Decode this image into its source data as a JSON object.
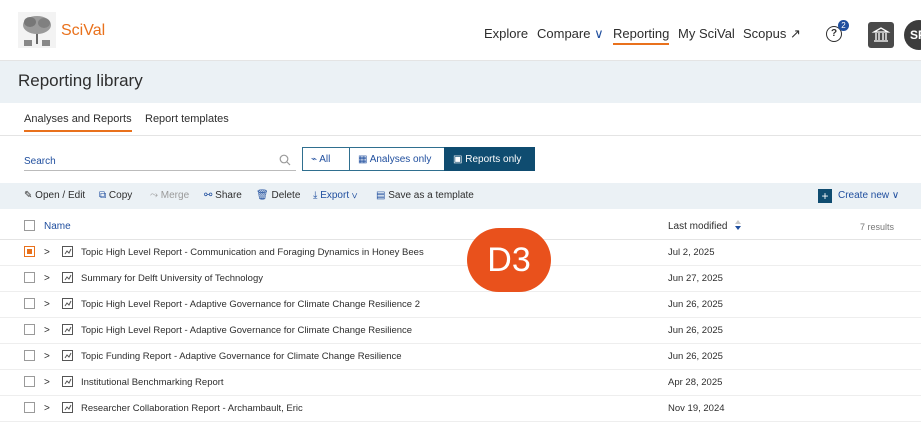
{
  "header": {
    "brand": "SciVal",
    "nav": [
      "Explore",
      "Compare",
      "Reporting",
      "My SciVal",
      "Scopus ↗"
    ],
    "compare_chevron": "∨",
    "help_glyph": "?",
    "help_badge": "2",
    "avatar_initials": "SF"
  },
  "page": {
    "title": "Reporting library"
  },
  "tabs": [
    "Analyses and Reports",
    "Report templates"
  ],
  "filters": {
    "search_label": "Search",
    "segments": [
      "All",
      "Analyses only",
      "Reports only"
    ],
    "selected": "Reports only"
  },
  "toolbar": {
    "open_edit": "Open / Edit",
    "copy": "Copy",
    "merge": "Merge",
    "share": "Share",
    "delete": "Delete",
    "export": "Export",
    "save_template": "Save as a template",
    "create_new": "Create new"
  },
  "table": {
    "col_name": "Name",
    "col_modified": "Last modified",
    "results": "7 results",
    "rows": [
      {
        "name": "Topic High Level Report - Communication and Foraging Dynamics in Honey Bees",
        "date": "Jul 2, 2025",
        "checked": true
      },
      {
        "name": "Summary for Delft University of Technology",
        "date": "Jun 27, 2025",
        "checked": false
      },
      {
        "name": "Topic High Level Report - Adaptive Governance for Climate Change Resilience 2",
        "date": "Jun 26, 2025",
        "checked": false
      },
      {
        "name": "Topic High Level Report - Adaptive Governance for Climate Change Resilience",
        "date": "Jun 26, 2025",
        "checked": false
      },
      {
        "name": "Topic Funding Report - Adaptive Governance for Climate Change Resilience",
        "date": "Jun 26, 2025",
        "checked": false
      },
      {
        "name": "Institutional Benchmarking Report",
        "date": "Apr 28, 2025",
        "checked": false
      },
      {
        "name": "Researcher Collaboration Report - Archambault, Eric",
        "date": "Nov 19, 2024",
        "checked": false
      }
    ]
  },
  "overlay": {
    "label": "D3"
  },
  "colors": {
    "accent": "#e9711c",
    "primary": "#0f4c70",
    "link": "#1f4e9e",
    "overlay": "#e9511c"
  }
}
